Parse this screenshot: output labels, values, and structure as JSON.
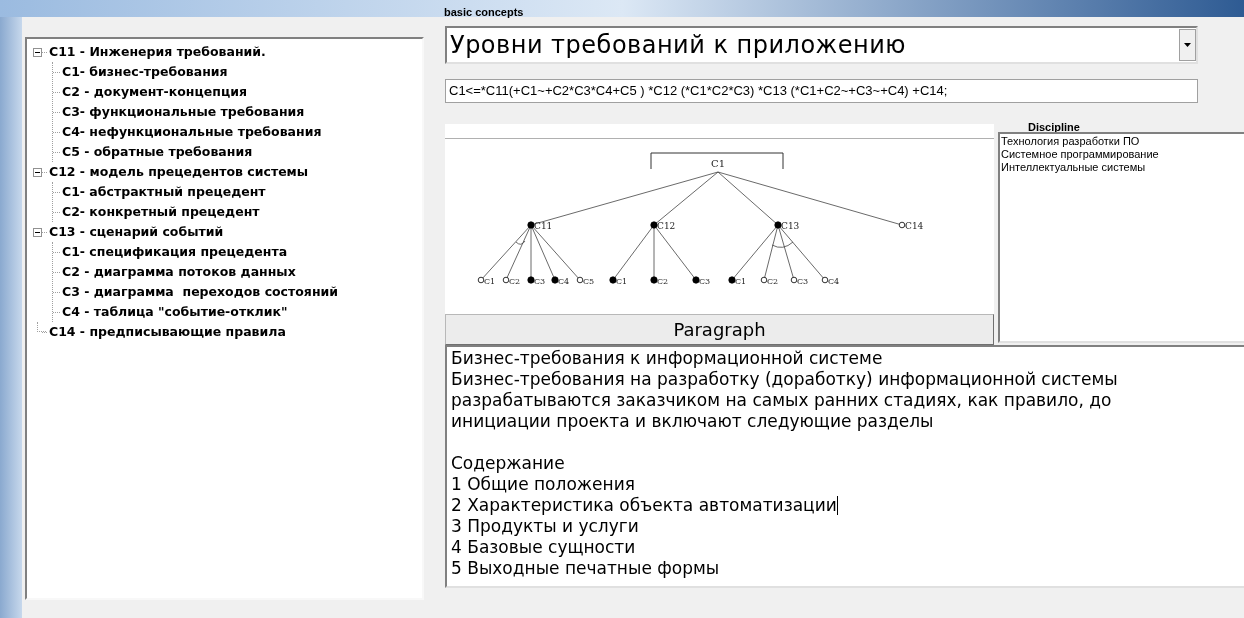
{
  "tree": [
    {
      "label": "C11 - Инженерия требований.",
      "expanded": true,
      "children": [
        {
          "label": "C1- бизнес-требования"
        },
        {
          "label": "C2 - документ-концепция"
        },
        {
          "label": "C3- функциональные требования"
        },
        {
          "label": "C4- нефункциональные требования"
        },
        {
          "label": "C5 - обратные требования"
        }
      ]
    },
    {
      "label": "C12 - модель прецедентов системы",
      "expanded": true,
      "children": [
        {
          "label": "C1- абстрактный прецедент"
        },
        {
          "label": "C2- конкретный прецедент"
        }
      ]
    },
    {
      "label": "C13 - сценарий событий",
      "expanded": true,
      "children": [
        {
          "label": "C1- спецификация прецедента"
        },
        {
          "label": "C2 - диаграмма потоков данных"
        },
        {
          "label": "C3 - диаграмма  переходов состояний"
        },
        {
          "label": "C4 - таблица \"событие-отклик\""
        }
      ]
    },
    {
      "label": "C14 - предписывающие правила"
    }
  ],
  "concepts_label": "basic concepts",
  "concept_select": {
    "value": "Уровни требований к приложению"
  },
  "formula_field": {
    "value": "C1<=*C11(+C1~+C2*C3*C4+C5 ) *C12 (*C1*C2*C3) *C13  (*C1+C2~+C3~+C4) +C14;"
  },
  "diagram": {
    "root": "C1",
    "children": [
      {
        "label": "C11",
        "filled": true,
        "arc": true,
        "children": [
          {
            "label": "C1",
            "filled": false
          },
          {
            "label": "C2",
            "filled": false
          },
          {
            "label": "C3",
            "filled": true
          },
          {
            "label": "C4",
            "filled": true
          },
          {
            "label": "C5",
            "filled": false
          }
        ]
      },
      {
        "label": "C12",
        "filled": true,
        "arc": false,
        "children": [
          {
            "label": "C1",
            "filled": true
          },
          {
            "label": "C2",
            "filled": true
          },
          {
            "label": "C3",
            "filled": true
          }
        ]
      },
      {
        "label": "C13",
        "filled": true,
        "arc": true,
        "children": [
          {
            "label": "C1",
            "filled": true
          },
          {
            "label": "C2",
            "filled": false
          },
          {
            "label": "C3",
            "filled": false
          },
          {
            "label": "C4",
            "filled": false
          }
        ]
      },
      {
        "label": "C14",
        "filled": false,
        "arc": false
      }
    ]
  },
  "paragraph_button": "Paragraph",
  "discipline": {
    "label": "Discipline",
    "items": [
      "Технология разработки ПО",
      "Системное программирование",
      "Интеллектуальные системы"
    ]
  },
  "paragraph_blocks": [
    [
      {
        "text": "Бизнес-требования к информационной системе",
        "has_caret": false
      },
      {
        "text": "Бизнес-требования на разработку (доработку) информационной системы разрабатываются заказчиком на самых ранних стадиях, как правило, до инициации проекта и включают следующие разделы",
        "has_caret": false
      }
    ],
    [
      {
        "text": "Содержание",
        "has_caret": false
      },
      {
        "text": "1 Общие положения",
        "has_caret": false
      },
      {
        "text": "2 Характеристика объекта автоматизации",
        "has_caret": true
      },
      {
        "text": "3 Продукты и услуги",
        "has_caret": false
      },
      {
        "text": "4 Базовые сущности",
        "has_caret": false
      },
      {
        "text": "5 Выходные печатные формы",
        "has_caret": false
      }
    ]
  ]
}
